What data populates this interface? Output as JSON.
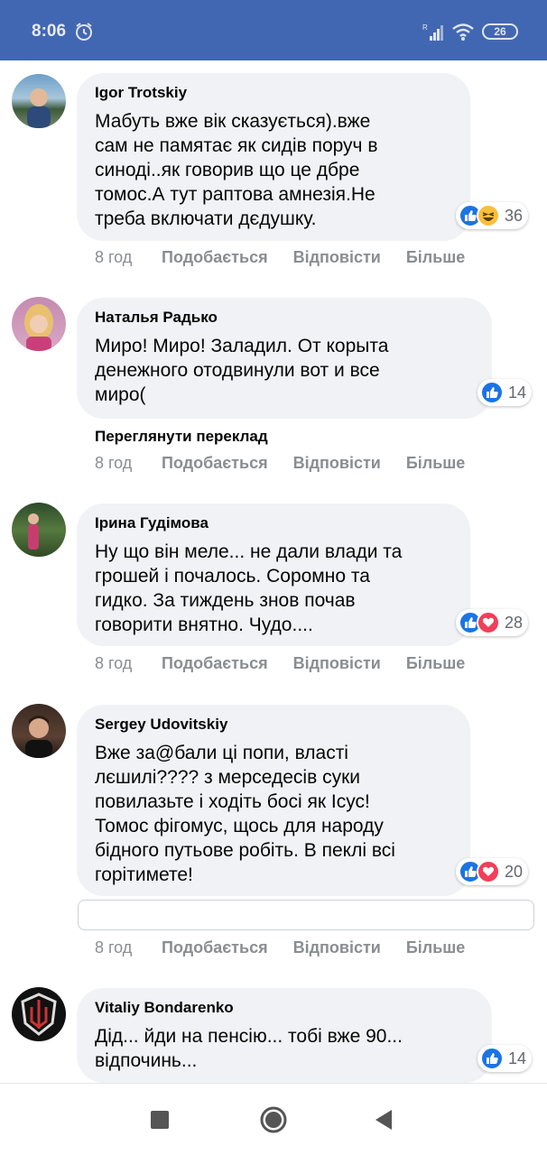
{
  "status_bar": {
    "time": "8:06",
    "battery": "26"
  },
  "actions": {
    "time": "8 год",
    "like": "Подобається",
    "reply": "Відповісти",
    "more": "Більше"
  },
  "translate_label": "Переглянути переклад",
  "comments": [
    {
      "author": "Igor Trotskiy",
      "text": "Мабуть вже вік сказується).вже\nсам не памятає як сидів поруч в\nсиноді..як говорив що це дбре\nтомос.А тут раптова амнезія.Не\nтреба включати дєдушку.",
      "reactions": [
        "like",
        "haha"
      ],
      "reaction_count": "36"
    },
    {
      "author": "Наталья Радько",
      "text": "Миро! Миро! Заладил. От корыта\nденежного отодвинули вот и все\nмиро(",
      "reactions": [
        "like"
      ],
      "reaction_count": "14"
    },
    {
      "author": "Ірина Гудімова",
      "text": "Ну що він меле... не дали влади та\nгрошей і почалось. Соромно та\nгидко. За тиждень знов почав\nговорити внятно. Чудо....",
      "reactions": [
        "like",
        "love"
      ],
      "reaction_count": "28"
    },
    {
      "author": "Sergey Udovitskiy",
      "text": "Вже за@бали ці попи, власті\nлєшилі???? з мерседесів суки\nповилазьте і ходіть босі як Ісус!\nТомос фігомус, щось для народу\nбідного путьове робіть. В пеклі всі\nгорітимете!",
      "reactions": [
        "like",
        "love"
      ],
      "reaction_count": "20"
    },
    {
      "author": "Vitaliy Bondarenko",
      "text": "Дід... йди на пенсію... тобі вже 90...\nвідпочинь...",
      "reactions": [
        "like"
      ],
      "reaction_count": "14"
    }
  ],
  "colors": {
    "header": "#4267b2",
    "like": "#1b74e4",
    "love": "#f33e58",
    "haha": "#f7c03b",
    "bubble": "#f0f2f5"
  },
  "icons": [
    "alarm-icon",
    "signal-icon",
    "wifi-icon",
    "like-icon",
    "haha-icon",
    "love-icon",
    "recents-icon",
    "home-icon",
    "back-icon"
  ]
}
